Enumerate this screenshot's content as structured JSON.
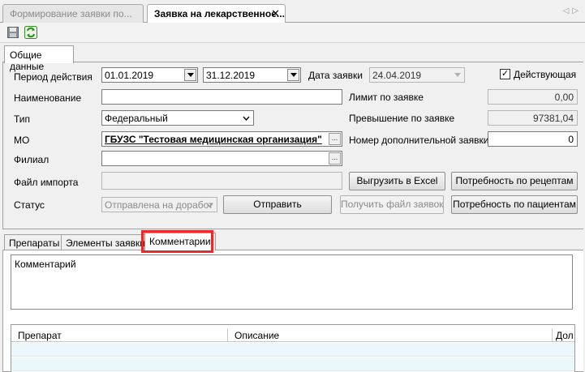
{
  "doc_tabs": [
    {
      "label": "Формирование заявки по...",
      "active": false
    },
    {
      "label": "Заявка на лекарственное...",
      "active": true
    }
  ],
  "toolbar": {
    "save_icon": "save-icon",
    "refresh_icon": "refresh-icon"
  },
  "general_tab": {
    "label": "Общие данные"
  },
  "form": {
    "period_label": "Период действия",
    "period_from": "01.01.2019",
    "period_to": "31.12.2019",
    "request_date_label": "Дата заявки",
    "request_date": "24.04.2019",
    "active_label": "Действующая",
    "active_checked": true,
    "name_label": "Наименование",
    "name_value": "",
    "type_label": "Тип",
    "type_value": "Федеральный",
    "mo_label": "МО",
    "mo_value": "ГБУЗС \"Тестовая медицинская организация\"",
    "branch_label": "Филиал",
    "branch_value": "",
    "import_label": "Файл импорта",
    "import_value": "",
    "status_label": "Статус",
    "status_value": "Отправлена на доработ",
    "limit_label": "Лимит по заявке",
    "limit_value": "0,00",
    "excess_label": "Превышение по заявке",
    "excess_value": "97381,04",
    "extra_num_label": "Номер дополнительной заявки",
    "extra_num_value": "0"
  },
  "buttons": {
    "export_excel": "Выгрузить в Excel",
    "need_recipes": "Потребность по рецептам",
    "send": "Отправить",
    "get_file": "Получить  файл заявок",
    "need_patients": "Потребность по пациентам"
  },
  "lower_tabs": [
    {
      "label": "Препараты",
      "active": false
    },
    {
      "label": "Элементы заявки",
      "active": false
    },
    {
      "label": "Комментарии",
      "active": true
    }
  ],
  "comment": {
    "placeholder": "Комментарий"
  },
  "grid": {
    "columns": [
      "Препарат",
      "Описание",
      "Дол"
    ]
  },
  "colors": {
    "highlight": "#e52b2b",
    "grid_row": "#eaf8fb"
  }
}
